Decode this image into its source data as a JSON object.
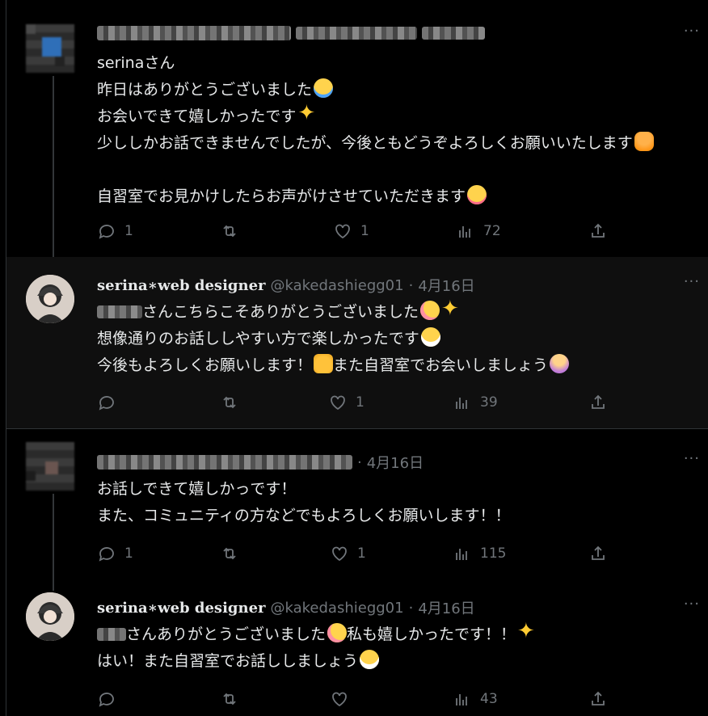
{
  "tweets": [
    {
      "name": "",
      "handle": "",
      "date": "",
      "lines": [
        "serinaさん",
        "昨日はありがとうございました",
        "お会いできて嬉しかったです",
        "少ししかお話できませんでしたが、今後ともどうぞよろしくお願いいたします",
        "",
        "自習室でお見かけしたらお声がけさせていただきます"
      ],
      "emojis": [
        "",
        "crying-face",
        "sparkles",
        "bowing-person",
        "",
        "smiling-face"
      ],
      "replies": "1",
      "retweets": "",
      "likes": "1",
      "views": "72"
    },
    {
      "name": "serina∗web designer",
      "handle": "@kakedashiegg01",
      "date": "4月16日",
      "lines": [
        "さんこちらこそありがとうございました",
        "想像通りのお話ししやすい方で楽しかったです",
        "今後もよろしくお願いします！",
        "また自習室でお会いしましょう"
      ],
      "replies": "",
      "retweets": "",
      "likes": "1",
      "views": "39"
    },
    {
      "name": "",
      "handle": "",
      "date": "4月16日",
      "lines": [
        "お話しできて嬉しかっです！",
        "また、コミュニティの方などでもよろしくお願いします！！"
      ],
      "replies": "1",
      "retweets": "",
      "likes": "1",
      "views": "115"
    },
    {
      "name": "serina∗web designer",
      "handle": "@kakedashiegg01",
      "date": "4月16日",
      "lines": [
        "さんありがとうございました",
        "私も嬉しかったです！！",
        "はい！また自習室でお話ししましょう"
      ],
      "replies": "",
      "retweets": "",
      "likes": "",
      "views": "43"
    }
  ],
  "ui": {
    "sep": "·",
    "more": "···"
  }
}
